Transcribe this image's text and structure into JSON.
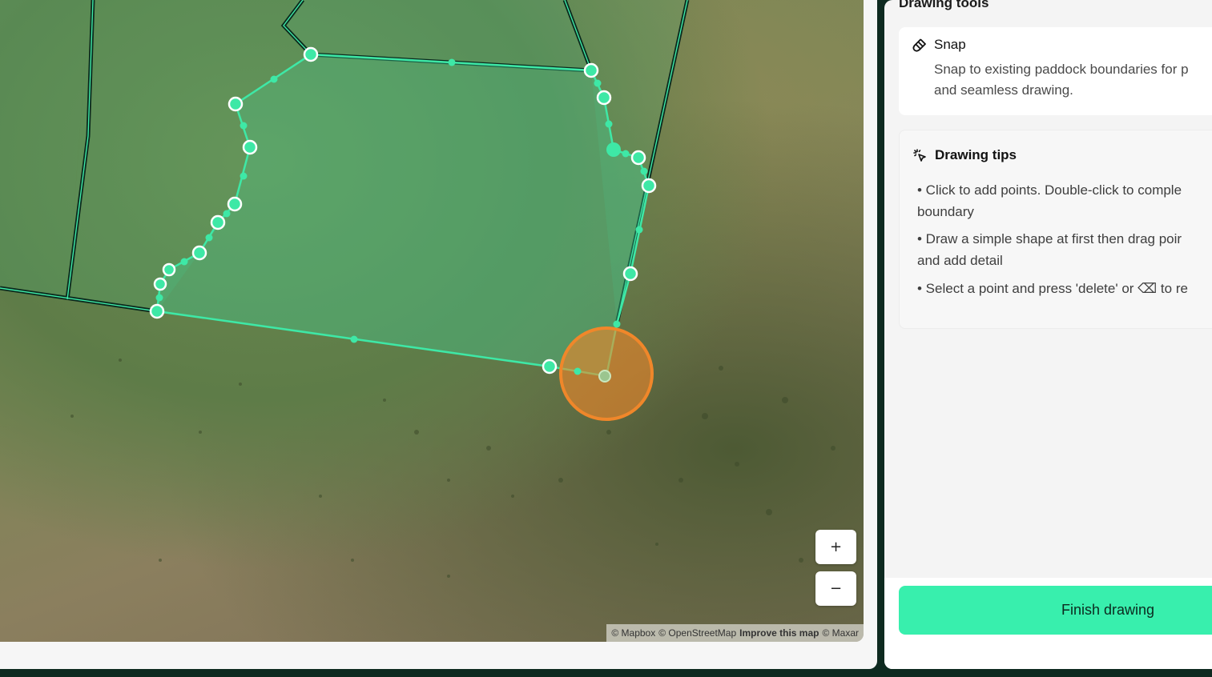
{
  "map": {
    "zoom_in_label": "+",
    "zoom_out_label": "−",
    "attribution": {
      "mapbox": "© Mapbox",
      "osm": "© OpenStreetMap",
      "improve": "Improve this map",
      "maxar": "© Maxar"
    },
    "colors": {
      "boundary": "#3ee8a6",
      "boundary_dark": "#0b2a1d",
      "fill": "#3fdc9e",
      "cursor": "#f0872a"
    }
  },
  "sidebar": {
    "heading": "Drawing tools",
    "snap": {
      "icon": "magnet-icon",
      "title": "Snap",
      "line1": "Snap to existing paddock boundaries for p",
      "line2": "and seamless drawing."
    },
    "tips": {
      "icon": "sparkle-cursor-icon",
      "title": "Drawing tips",
      "items": [
        {
          "line1": "• Click to add points. Double-click to comple",
          "line2": "boundary"
        },
        {
          "line1": "• Draw a simple shape at first then drag poir",
          "line2": "and add detail"
        },
        {
          "line1": "• Select a point and press 'delete' or ⌫ to re",
          "line2": ""
        }
      ]
    },
    "finish_label": "Finish drawing"
  }
}
